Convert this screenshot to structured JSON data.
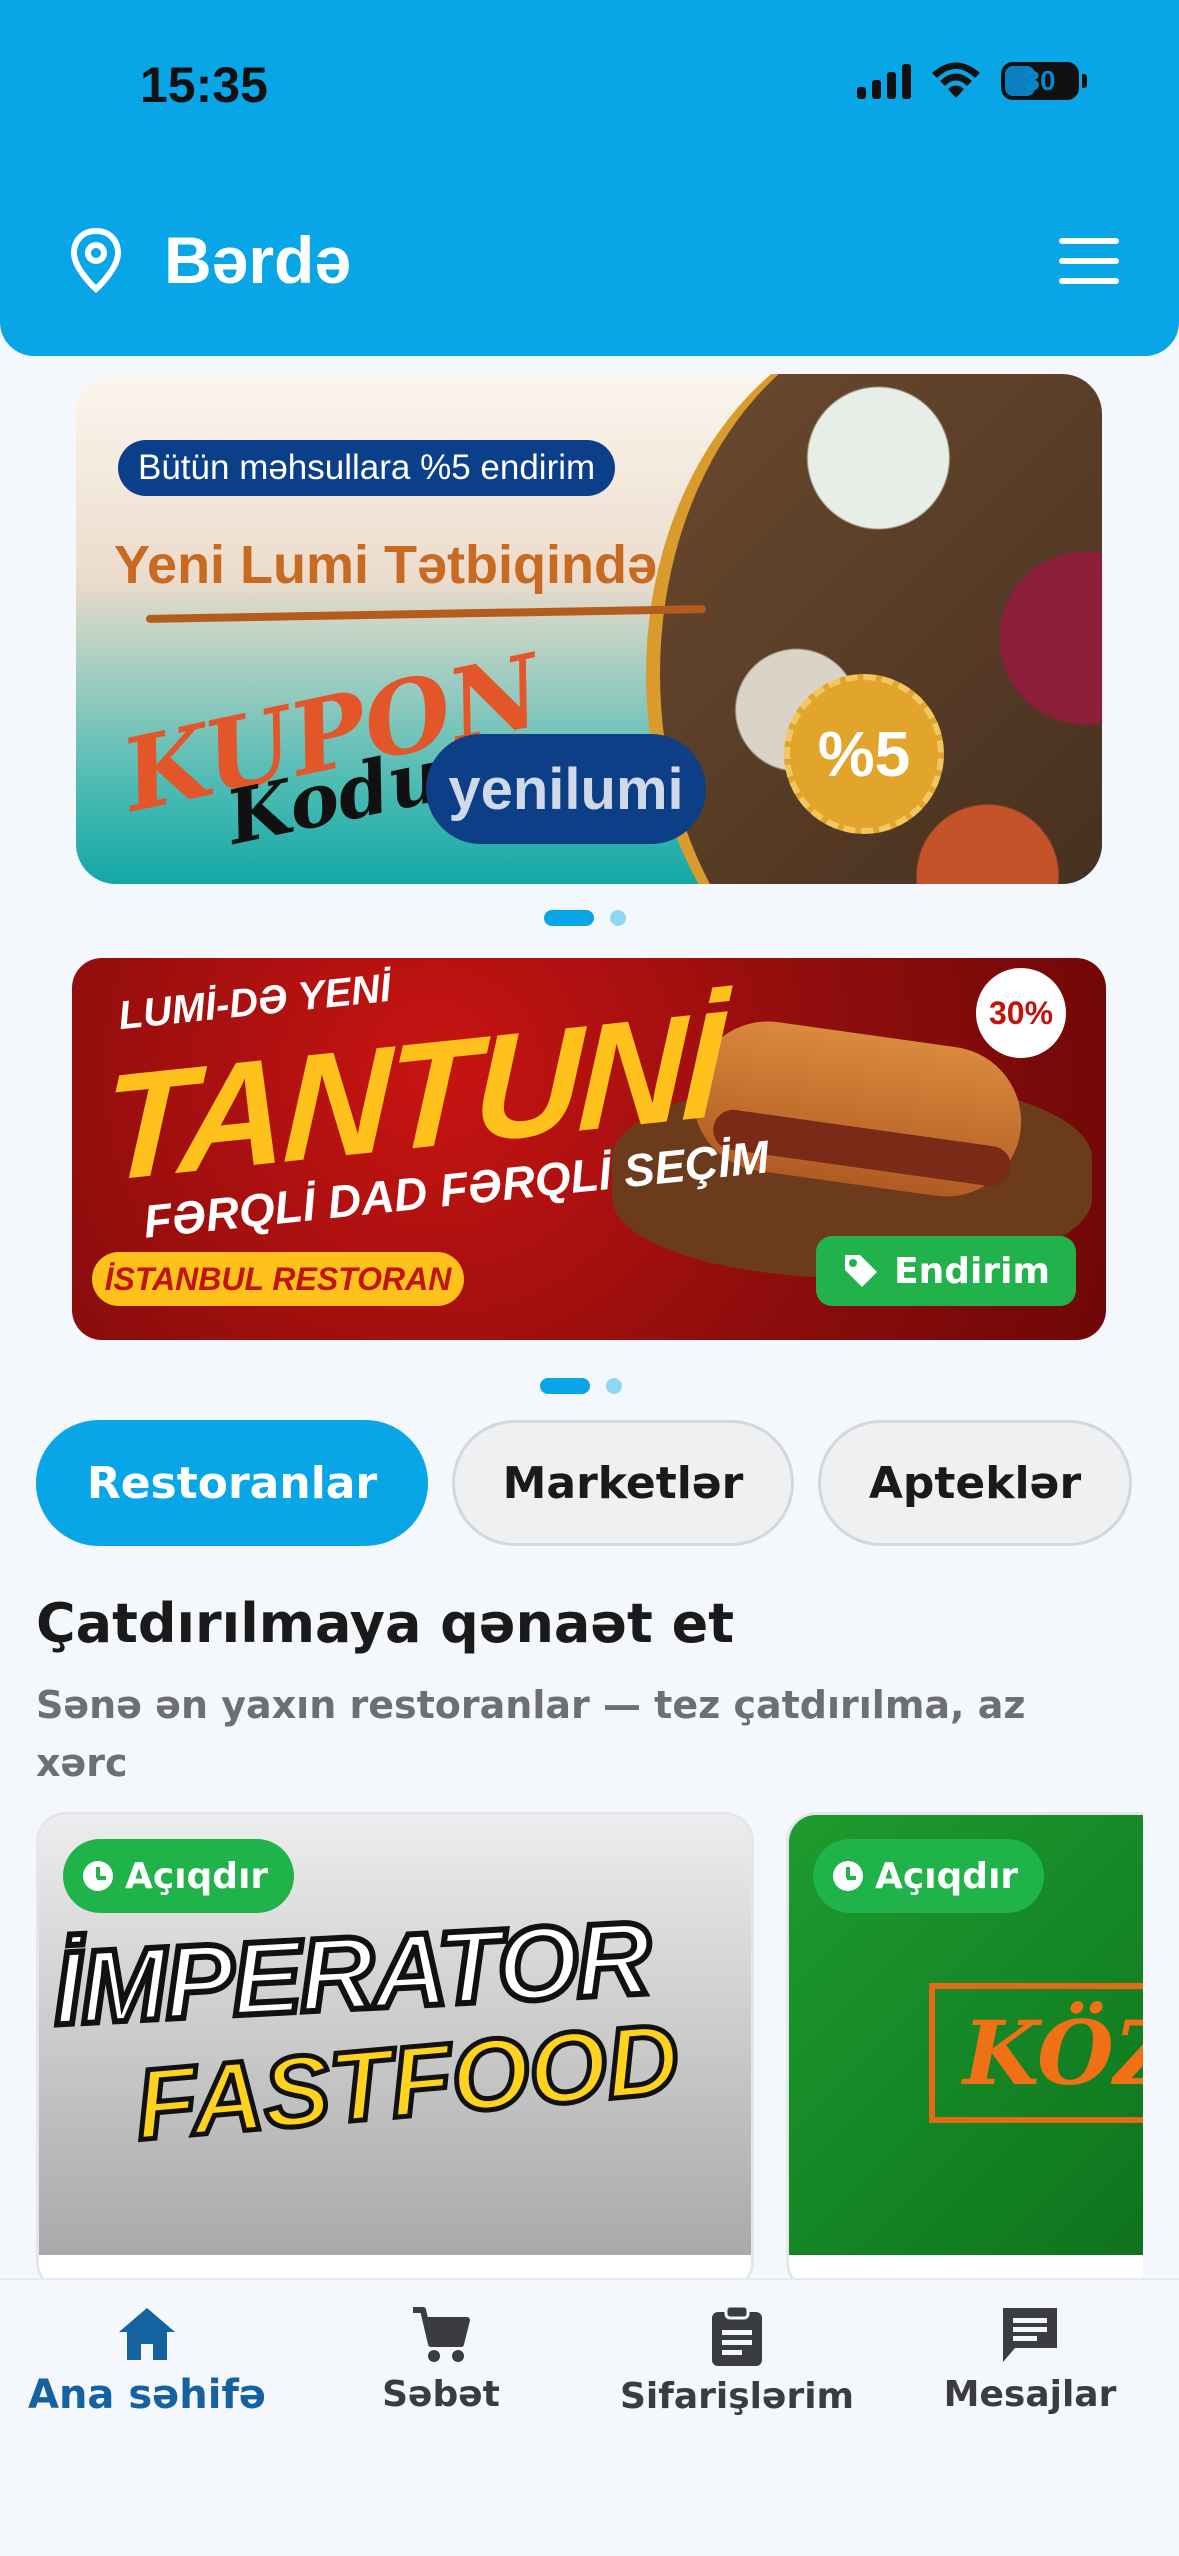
{
  "status_bar": {
    "time": "15:35",
    "battery": "30"
  },
  "header": {
    "city": "Bərdə"
  },
  "banner1": {
    "pill": "Bütün məhsullara %5 endirim",
    "title": "Yeni Lumi Tətbiqində",
    "kupon": "KUPON",
    "kodu": "Kodu",
    "code": "yenilumi",
    "badge": "%5"
  },
  "banner2": {
    "subtitle": "LUMİ-DƏ YENİ",
    "title": "TANTUNİ",
    "tagline": "FƏRQLİ DAD FƏRQLİ SEÇİM",
    "restaurant": "İSTANBUL RESTORAN",
    "percent": "30%",
    "discount_label": "Endirim"
  },
  "categories": [
    {
      "label": "Restoranlar",
      "active": true
    },
    {
      "label": "Marketlər",
      "active": false
    },
    {
      "label": "Apteklər",
      "active": false
    }
  ],
  "section": {
    "title": "Çatdırılmaya qənaət et",
    "subtitle": "Sənə ən yaxın restoranlar — tez çatdırılma, az xərc"
  },
  "restaurants": [
    {
      "status": "Açıqdır",
      "logo_line1": "İMPERATOR",
      "logo_line2": "FASTFOOD"
    },
    {
      "status": "Açıqdır",
      "logo_line1": "KÖZ U"
    }
  ],
  "bottom_nav": [
    {
      "label": "Ana səhifə",
      "icon": "home-icon",
      "active": true
    },
    {
      "label": "Səbət",
      "icon": "cart-icon",
      "active": false
    },
    {
      "label": "Sifarişlərim",
      "icon": "orders-icon",
      "active": false
    },
    {
      "label": "Mesajlar",
      "icon": "messages-icon",
      "active": false
    }
  ],
  "colors": {
    "primary": "#08a6e6",
    "open_green": "#20b34a",
    "nav_active": "#1462a0"
  }
}
